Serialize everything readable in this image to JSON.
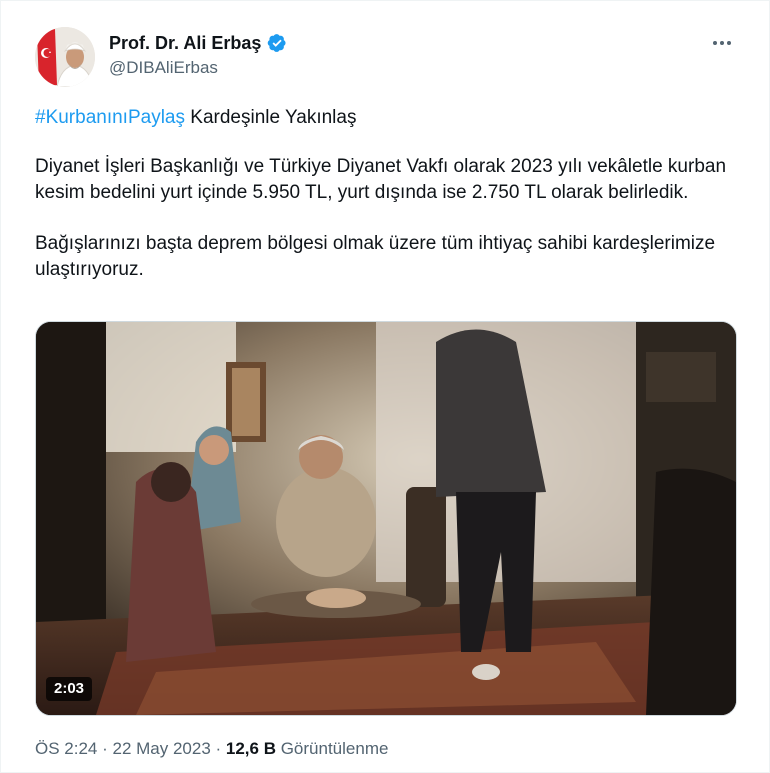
{
  "author": {
    "display_name": "Prof. Dr. Ali Erbaş",
    "handle": "@DIBAliErbas",
    "verified_icon": "verified-badge-icon"
  },
  "tweet": {
    "hashtag": "#KurbanınıPaylaş",
    "hashtag_suffix": " Kardeşinle Yakınlaş",
    "paragraph_2": "Diyanet İşleri Başkanlığı ve Türkiye Diyanet Vakfı olarak 2023 yılı vekâletle kurban kesim bedelini yurt içinde 5.950 TL, yurt dışında ise 2.750 TL olarak belirledik.",
    "paragraph_3": "Bağışlarınızı başta deprem bölgesi olmak üzere tüm ihtiyaç sahibi kardeşlerimize ulaştırıyoruz."
  },
  "media": {
    "duration": "2:03"
  },
  "meta": {
    "time": "ÖS 2:24",
    "separator": " · ",
    "date": "22 May 2023",
    "views_count": "12,6 B",
    "views_label": " Görüntülenme"
  },
  "colors": {
    "hashtag": "#1d9bf0",
    "verified": "#1d9bf0",
    "secondary_text": "#536471"
  }
}
